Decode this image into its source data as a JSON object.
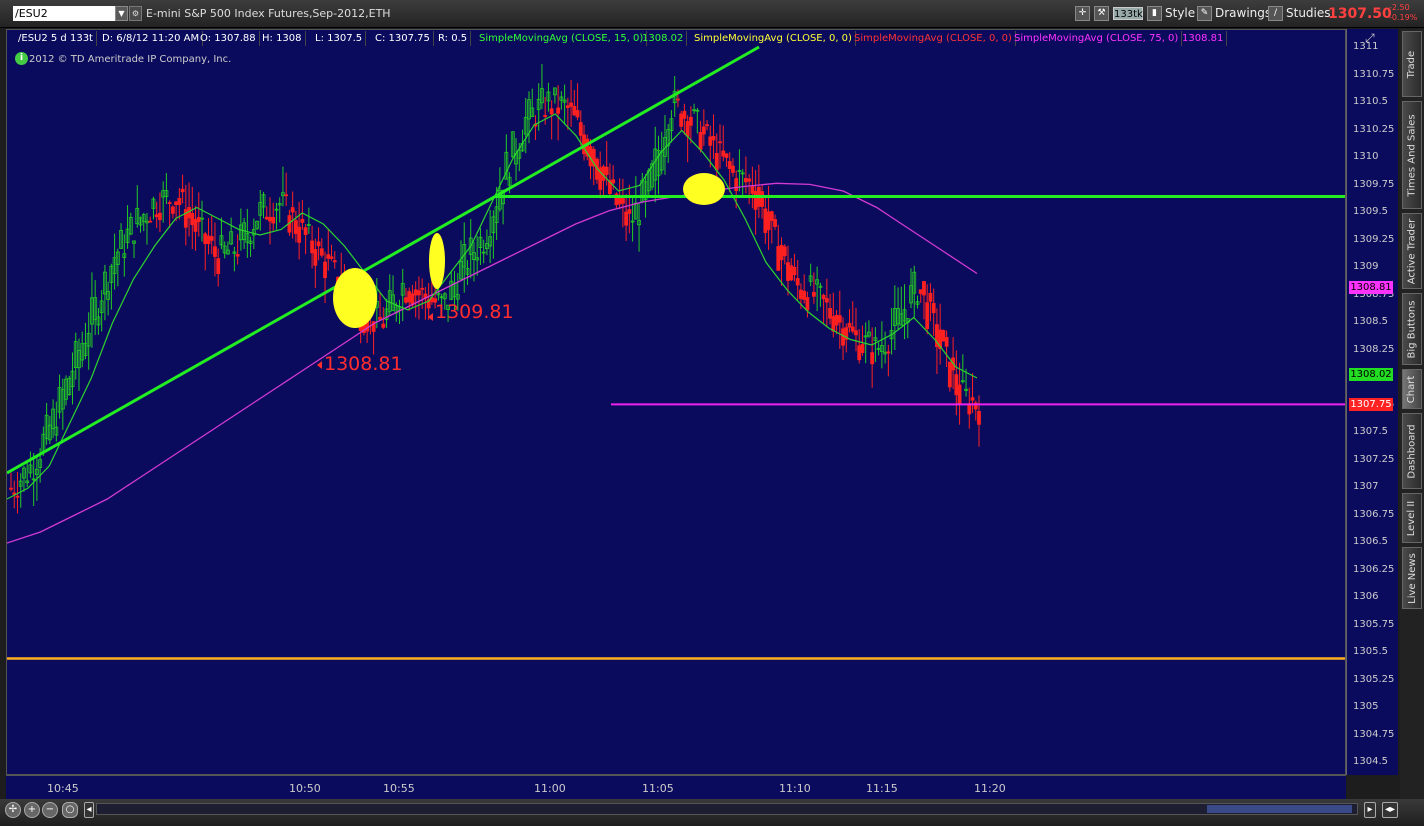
{
  "toolbar": {
    "symbol": "/ESU2",
    "instrument": "E-mini S&P 500 Index Futures,Sep-2012,ETH",
    "tick_badge": "133tk",
    "style_label": "Style",
    "drawings_label": "Drawings",
    "studies_label": "Studies",
    "last_price": "1307.50",
    "change": "-2.50",
    "change_pct": "-0.19%"
  },
  "info_bar": {
    "symbol_period": "/ESU2 5 d 133t",
    "date": "D: 6/8/12 11:20 AM",
    "open": "O: 1307.88",
    "high": "H: 1308",
    "low": "L: 1307.5",
    "close": "C: 1307.75",
    "range": "R: 0.5",
    "study1": "SimpleMovingAvg (CLOSE, 15, 0)",
    "study1_value": "1308.02",
    "study2": "SimpleMovingAvg (CLOSE, 0, 0)",
    "study3": "SimpleMovingAvg (CLOSE, 0, 0)",
    "study4": "SimpleMovingAvg (CLOSE, 75, 0)",
    "study4_value": "1308.81",
    "colors": {
      "study1": "#33ff33",
      "study2": "#ffff33",
      "study3": "#ff3333",
      "study4": "#ff33ff"
    }
  },
  "copyright": "2012 © TD Ameritrade IP Company, Inc.",
  "annotations": {
    "label1": "1308.81",
    "label2": "1309.81"
  },
  "price_axis": {
    "ticks": [
      "1311",
      "1310.75",
      "1310.5",
      "1310.25",
      "1310",
      "1309.75",
      "1309.5",
      "1309.25",
      "1309",
      "1308.75",
      "1308.5",
      "1308.25",
      "1308",
      "1307.75",
      "1307.5",
      "1307.25",
      "1307",
      "1306.75",
      "1306.5",
      "1306.25",
      "1306",
      "1305.75",
      "1305.5",
      "1305.25",
      "1305",
      "1304.75",
      "1304.5"
    ],
    "badge_sma75": "1308.81",
    "badge_sma15": "1308.02",
    "badge_last": "1307.75"
  },
  "time_axis": {
    "ticks": [
      "10:45",
      "10:50",
      "10:55",
      "11:00",
      "11:05",
      "11:10",
      "11:15",
      "11:20"
    ]
  },
  "side_tabs": [
    "Trade",
    "Times And Sales",
    "Active Trader",
    "Big Buttons",
    "Chart",
    "Dashboard",
    "Level II",
    "Live News"
  ],
  "chart_data": {
    "type": "candlestick",
    "title": "/ESU2 5 d 133t",
    "ylim": [
      1304.4,
      1311.1
    ],
    "price_lines": {
      "green_horizontal": 1309.65,
      "magenta_horizontal": 1307.76,
      "orange_horizontal": 1305.45
    },
    "sma15": [
      1306.9,
      1307.0,
      1307.2,
      1307.6,
      1308.0,
      1308.5,
      1308.9,
      1309.2,
      1309.45,
      1309.55,
      1309.45,
      1309.35,
      1309.3,
      1309.35,
      1309.5,
      1309.4,
      1309.2,
      1308.95,
      1308.7,
      1308.62,
      1308.7,
      1308.95,
      1309.2,
      1309.6,
      1310.0,
      1310.3,
      1310.4,
      1310.2,
      1309.9,
      1309.7,
      1309.75,
      1310.05,
      1310.25,
      1310.05,
      1309.8,
      1309.45,
      1309.05,
      1308.8,
      1308.6,
      1308.45,
      1308.35,
      1308.3,
      1308.4,
      1308.55,
      1308.35,
      1308.1,
      1308.0
    ],
    "sma75": [
      1306.5,
      1306.6,
      1306.75,
      1306.9,
      1307.1,
      1307.3,
      1307.5,
      1307.7,
      1307.9,
      1308.1,
      1308.3,
      1308.5,
      1308.65,
      1308.8,
      1308.95,
      1309.1,
      1309.25,
      1309.4,
      1309.52,
      1309.6,
      1309.65,
      1309.7,
      1309.74,
      1309.77,
      1309.76,
      1309.7,
      1309.55,
      1309.35,
      1309.15,
      1308.95
    ],
    "close": [
      1307.0,
      1307.2,
      1307.6,
      1308.1,
      1308.6,
      1309.1,
      1309.4,
      1309.6,
      1309.65,
      1309.35,
      1309.1,
      1309.2,
      1309.5,
      1309.6,
      1309.35,
      1309.1,
      1308.85,
      1308.6,
      1308.5,
      1308.85,
      1308.75,
      1308.65,
      1309.05,
      1309.3,
      1309.9,
      1310.35,
      1310.5,
      1310.45,
      1310.1,
      1309.7,
      1309.4,
      1309.75,
      1310.5,
      1310.35,
      1310.1,
      1309.85,
      1309.75,
      1309.25,
      1308.85,
      1308.75,
      1308.55,
      1308.35,
      1308.25,
      1308.5,
      1308.85,
      1308.35,
      1307.85,
      1307.75
    ],
    "open": [
      1306.9,
      1307.05,
      1307.3,
      1307.7,
      1308.2,
      1308.7,
      1309.2,
      1309.45,
      1309.7,
      1309.6,
      1309.35,
      1309.05,
      1309.25,
      1309.45,
      1309.6,
      1309.35,
      1309.05,
      1308.85,
      1308.6,
      1308.55,
      1308.8,
      1308.75,
      1308.7,
      1309.0,
      1309.35,
      1309.9,
      1310.3,
      1310.55,
      1310.4,
      1310.1,
      1309.7,
      1309.45,
      1309.8,
      1310.45,
      1310.3,
      1310.05,
      1309.85,
      1309.7,
      1309.2,
      1308.85,
      1308.75,
      1308.5,
      1308.3,
      1308.3,
      1308.55,
      1308.8,
      1308.3,
      1307.85
    ]
  }
}
